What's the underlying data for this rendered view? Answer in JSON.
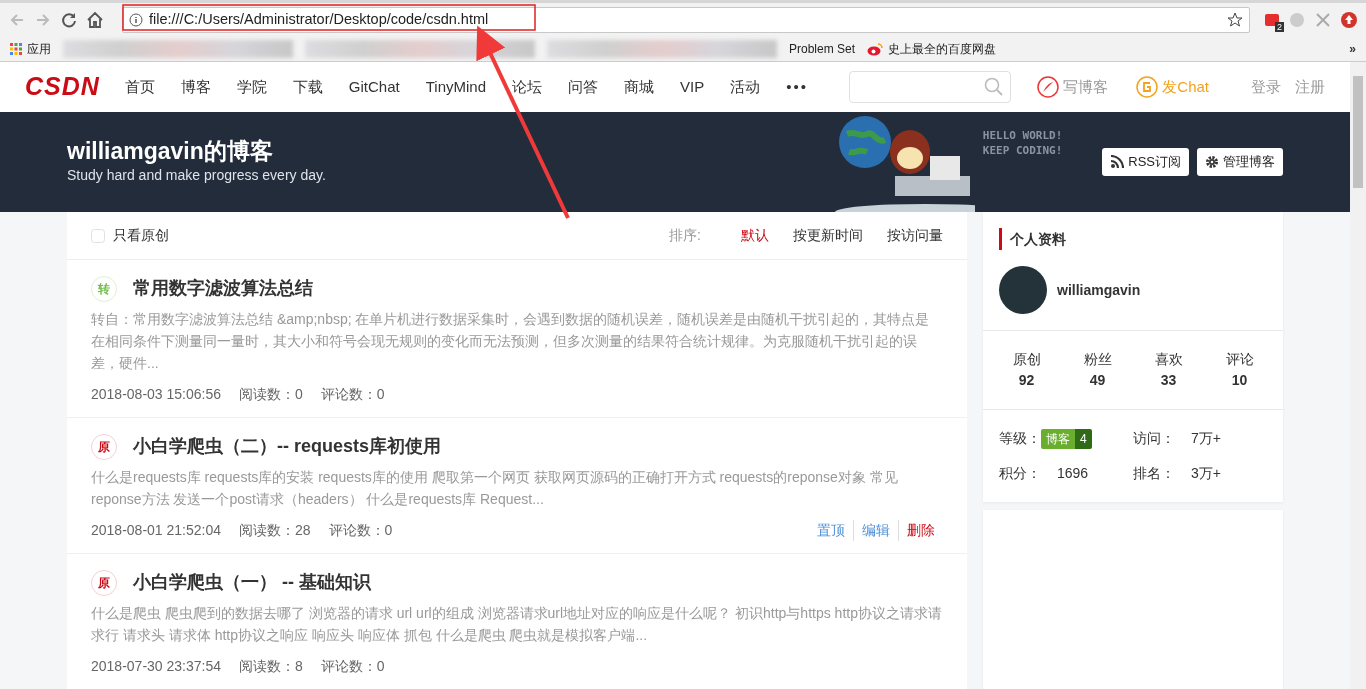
{
  "browser": {
    "url": "file:///C:/Users/Administrator/Desktop/code/csdn.html",
    "extension_badge": "2",
    "bookmarks": [
      {
        "kind": "apps",
        "label": "应用"
      },
      {
        "kind": "blurred"
      },
      {
        "kind": "blurred"
      },
      {
        "kind": "blurred"
      },
      {
        "kind": "plain",
        "label": "Problem Set"
      },
      {
        "kind": "weibo",
        "label": "史上最全的百度网盘"
      }
    ],
    "overflow": "»"
  },
  "site_nav": {
    "logo": "CSDN",
    "items": [
      "首页",
      "博客",
      "学院",
      "下载",
      "GitChat",
      "TinyMind",
      "论坛",
      "问答",
      "商城",
      "VIP",
      "活动"
    ],
    "more": "•••",
    "actions": [
      {
        "kind": "write",
        "label": "写博客"
      },
      {
        "kind": "chat",
        "label": "发Chat"
      }
    ],
    "login": "登录",
    "register": "注册"
  },
  "banner": {
    "title": "williamgavin的博客",
    "subtitle": "Study hard and make progress every day.",
    "art_text": [
      "HELLO WORLD!",
      "KEEP CODING!"
    ],
    "buttons": [
      {
        "kind": "rss",
        "label": "RSS订阅"
      },
      {
        "kind": "manage",
        "label": "管理博客"
      }
    ]
  },
  "toolbar": {
    "filter": {
      "label": "只看原创",
      "checked": false
    },
    "sort_label": "排序:",
    "sort_options": [
      {
        "label": "默认",
        "selected": true
      },
      {
        "label": "按更新时间",
        "selected": false
      },
      {
        "label": "按访问量",
        "selected": false
      }
    ]
  },
  "articles": [
    {
      "kind": "repost",
      "tag": "转",
      "title": "常用数字滤波算法总结",
      "summary": "转自：常用数字滤波算法总结 &amp;nbsp; 在单片机进行数据采集时，会遇到数据的随机误差，随机误差是由随机干扰引起的，其特点是在相同条件下测量同一量时，其大小和符号会现无规则的变化而无法预测，但多次测量的结果符合统计规律。为克服随机干扰引起的误差，硬件...",
      "date": "2018-08-03 15:06:56",
      "reads": "阅读数：0",
      "comments": "评论数：0"
    },
    {
      "kind": "original",
      "tag": "原",
      "title": "小白学爬虫（二）-- requests库初使用",
      "summary": "什么是requests库 requests库的安装 requests库的使用 爬取第一个网页 获取网页源码的正确打开方式 requests的reponse对象 常见reponse方法 发送一个post请求（headers） 什么是requests库 Request...",
      "date": "2018-08-01 21:52:04",
      "reads": "阅读数：28",
      "comments": "评论数：0",
      "actions": [
        {
          "kind": "normal",
          "label": "置顶"
        },
        {
          "kind": "normal",
          "label": "编辑"
        },
        {
          "kind": "danger",
          "label": "删除"
        }
      ]
    },
    {
      "kind": "original",
      "tag": "原",
      "title": "小白学爬虫（一） -- 基础知识",
      "summary": "什么是爬虫 爬虫爬到的数据去哪了 浏览器的请求 url url的组成 浏览器请求url地址对应的响应是什么呢？ 初识http与https http协议之请求请求行 请求头 请求体 http协议之响应 响应头 响应体 抓包 什么是爬虫 爬虫就是模拟客户端...",
      "date": "2018-07-30 23:37:54",
      "reads": "阅读数：8",
      "comments": "评论数：0"
    }
  ],
  "profile": {
    "heading": "个人资料",
    "username": "williamgavin",
    "stats": [
      {
        "label": "原创",
        "value": "92"
      },
      {
        "label": "粉丝",
        "value": "49"
      },
      {
        "label": "喜欢",
        "value": "33"
      },
      {
        "label": "评论",
        "value": "10"
      }
    ],
    "level_label": "等级：",
    "level_badge": "博客",
    "level": "4",
    "visits_label": "访问：",
    "visits": "7万+",
    "points_label": "积分：",
    "points": "1696",
    "rank_label": "排名：",
    "rank": "3万+"
  }
}
